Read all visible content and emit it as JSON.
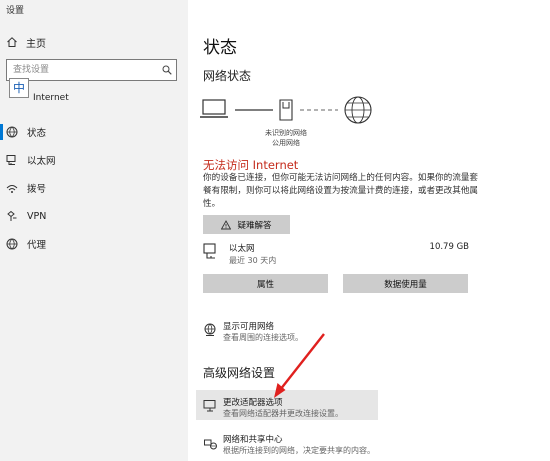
{
  "window": {
    "title": "设置"
  },
  "sidebar": {
    "home_label": "主页",
    "search_placeholder": "查找设置",
    "ime_indicator": "中",
    "section_header": "Internet",
    "items": [
      {
        "label": "状态",
        "icon": "status-globe-icon"
      },
      {
        "label": "以太网",
        "icon": "ethernet-icon"
      },
      {
        "label": "拨号",
        "icon": "dialup-icon"
      },
      {
        "label": "VPN",
        "icon": "vpn-icon"
      },
      {
        "label": "代理",
        "icon": "proxy-globe-icon"
      }
    ]
  },
  "main": {
    "title": "状态",
    "network_status_heading": "网络状态",
    "diagram": {
      "network_label_line1": "未识别的网络",
      "network_label_line2": "公用网络"
    },
    "error_title": "无法访问 Internet",
    "error_description": "你的设备已连接，但你可能无法访问网络上的任何内容。如果你的流量套餐有限制，则你可以将此网络设置为按流量计费的连接，或者更改其他属性。",
    "troubleshoot_label": "疑难解答",
    "connection": {
      "name": "以太网",
      "sub": "最近 30 天内",
      "data_used": "10.79 GB"
    },
    "properties_label": "属性",
    "data_usage_label": "数据使用量",
    "show_networks": {
      "title": "显示可用网络",
      "sub": "查看周围的连接选项。"
    },
    "advanced_heading": "高级网络设置",
    "adapter_options": {
      "title": "更改适配器选项",
      "sub": "查看网络适配器并更改连接设置。"
    },
    "sharing_center": {
      "title": "网络和共享中心",
      "sub": "根据所连接到的网络，决定要共享的内容。"
    }
  },
  "colors": {
    "sidebar_bg": "#f2f2f2",
    "accent": "#0078d4",
    "error": "#c42b1c",
    "button_bg": "#cccccc",
    "annotation_arrow": "#e0201e"
  }
}
